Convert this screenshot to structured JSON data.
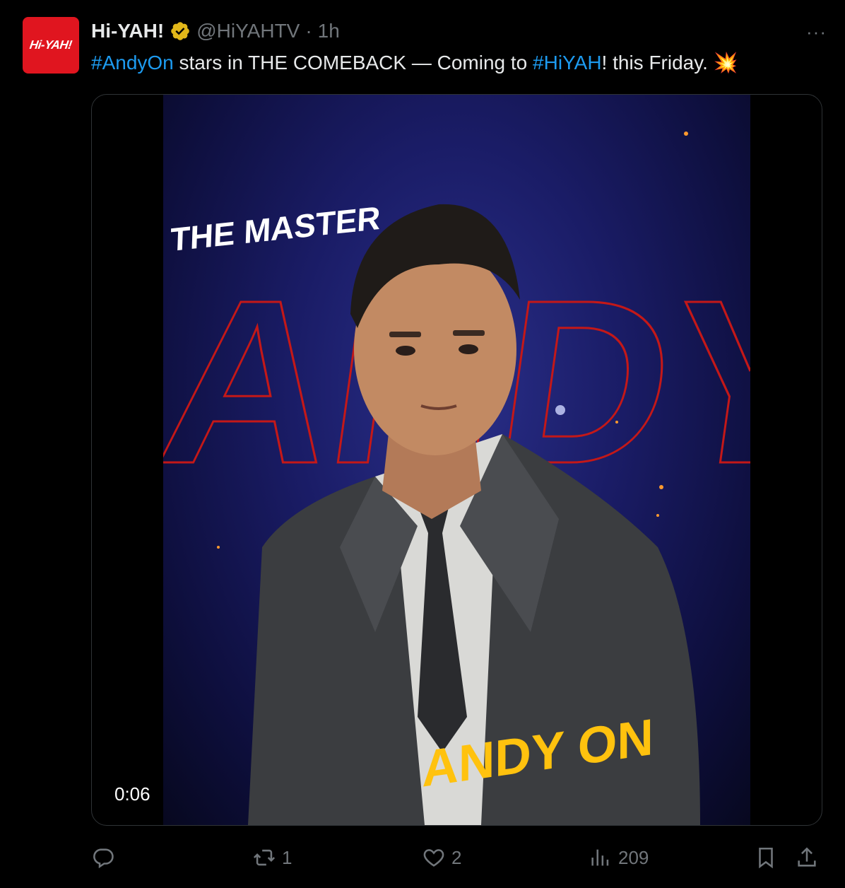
{
  "account": {
    "avatar_text": "Hi-YAH!",
    "name": "Hi-YAH!",
    "handle": "@HiYAHTV",
    "separator": "·",
    "time": "1h",
    "more_label": "···",
    "verified_icon": "gold-verified-badge-icon"
  },
  "tweet": {
    "hashtag1": "#AndyOn",
    "text1": " stars in THE COMEBACK — Coming to ",
    "hashtag2": "#HiYAH",
    "text2": "! this Friday. ",
    "emoji": "💥"
  },
  "media": {
    "poster_title": "THE MASTER",
    "poster_name": "ANDY ON",
    "background_text": "ANDY ON",
    "video_time": "0:06",
    "colors": {
      "background": "#1a1c66",
      "outline_text": "#c41818",
      "name_text": "#ffc20e"
    }
  },
  "actions": {
    "reply_count": "",
    "repost_count": "1",
    "like_count": "2",
    "views_count": "209"
  },
  "colors": {
    "link": "#1d9bf0",
    "muted": "#71767b",
    "text": "#e7e9ea",
    "brand": "#e0151f"
  }
}
